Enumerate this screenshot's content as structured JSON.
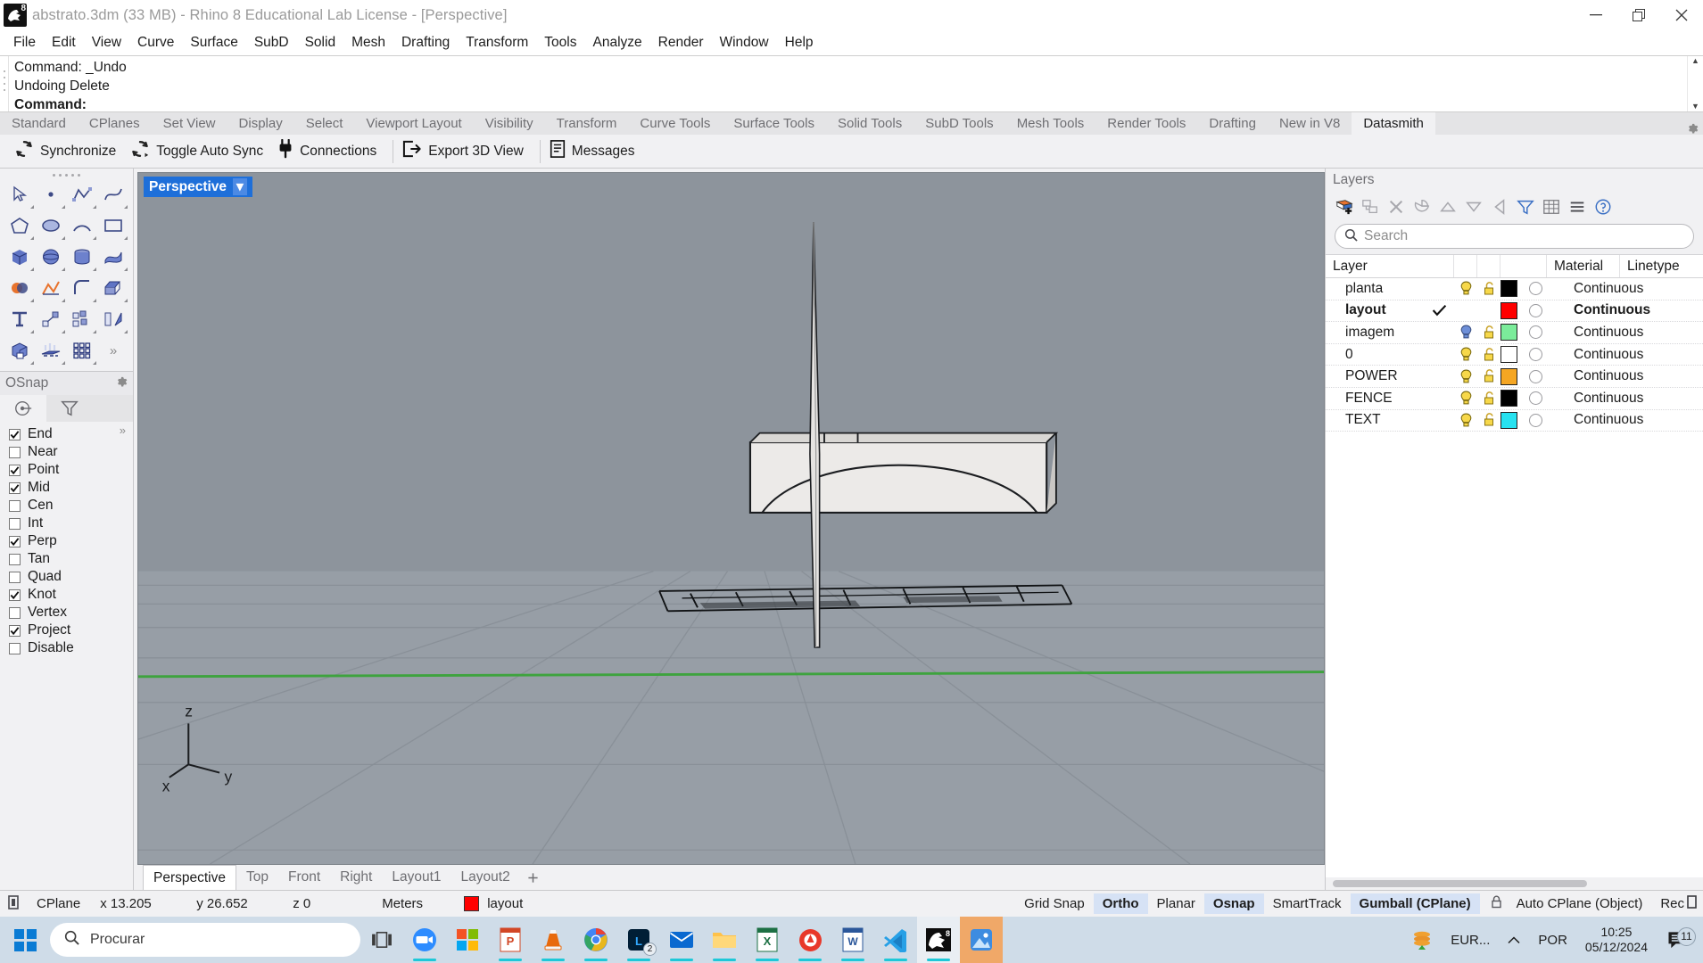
{
  "titlebar": {
    "title": "abstrato.3dm (33 MB) - Rhino 8 Educational Lab License - [Perspective]",
    "app_icon": "rhino-icon",
    "minimize": "minimize-icon",
    "restore": "restore-icon",
    "close": "close-icon"
  },
  "menu": [
    "File",
    "Edit",
    "View",
    "Curve",
    "Surface",
    "SubD",
    "Solid",
    "Mesh",
    "Drafting",
    "Transform",
    "Tools",
    "Analyze",
    "Render",
    "Window",
    "Help"
  ],
  "command": {
    "line1": "Command: _Undo",
    "line2": "Undoing Delete",
    "line3": "Command:"
  },
  "toolbar_tabs": [
    {
      "label": "Standard",
      "active": false
    },
    {
      "label": "CPlanes",
      "active": false
    },
    {
      "label": "Set View",
      "active": false
    },
    {
      "label": "Display",
      "active": false
    },
    {
      "label": "Select",
      "active": false
    },
    {
      "label": "Viewport Layout",
      "active": false
    },
    {
      "label": "Visibility",
      "active": false
    },
    {
      "label": "Transform",
      "active": false
    },
    {
      "label": "Curve Tools",
      "active": false
    },
    {
      "label": "Surface Tools",
      "active": false
    },
    {
      "label": "Solid Tools",
      "active": false
    },
    {
      "label": "SubD Tools",
      "active": false
    },
    {
      "label": "Mesh Tools",
      "active": false
    },
    {
      "label": "Render Tools",
      "active": false
    },
    {
      "label": "Drafting",
      "active": false
    },
    {
      "label": "New in V8",
      "active": false
    },
    {
      "label": "Datasmith",
      "active": true
    }
  ],
  "datasmith_toolbar": [
    {
      "label": "Synchronize",
      "icon": "sync-icon"
    },
    {
      "label": "Toggle Auto Sync",
      "icon": "auto-sync-icon"
    },
    {
      "label": "Connections",
      "icon": "plug-icon"
    },
    {
      "label": "Export 3D View",
      "icon": "export-icon"
    },
    {
      "label": "Messages",
      "icon": "messages-icon"
    }
  ],
  "osnap": {
    "title": "OSnap",
    "gear": "gear-icon",
    "tab_snap": "snap-target-icon",
    "tab_filter": "filter-icon",
    "items": [
      {
        "label": "End",
        "checked": true
      },
      {
        "label": "Near",
        "checked": false
      },
      {
        "label": "Point",
        "checked": true
      },
      {
        "label": "Mid",
        "checked": true
      },
      {
        "label": "Cen",
        "checked": false
      },
      {
        "label": "Int",
        "checked": false
      },
      {
        "label": "Perp",
        "checked": true
      },
      {
        "label": "Tan",
        "checked": false
      },
      {
        "label": "Quad",
        "checked": false
      },
      {
        "label": "Knot",
        "checked": true
      },
      {
        "label": "Vertex",
        "checked": false
      },
      {
        "label": "Project",
        "checked": true
      },
      {
        "label": "Disable",
        "checked": false
      }
    ]
  },
  "viewport": {
    "label": "Perspective",
    "caret": "▾",
    "axis_z": "z",
    "axis_x": "x",
    "axis_y": "y",
    "background": "#8d949c",
    "ground": "#9aa1a8",
    "grid_line": "#7e848b",
    "axis_green": "#3ea33e"
  },
  "viewport_tabs": [
    {
      "label": "Perspective",
      "active": true
    },
    {
      "label": "Top",
      "active": false
    },
    {
      "label": "Front",
      "active": false
    },
    {
      "label": "Right",
      "active": false
    },
    {
      "label": "Layout1",
      "active": false
    },
    {
      "label": "Layout2",
      "active": false
    }
  ],
  "layers": {
    "title": "Layers",
    "search_placeholder": "Search",
    "search_value": "",
    "search_icon": "search-icon",
    "tools": [
      "new-layer-icon",
      "new-sublayer-icon",
      "delete-layer-icon",
      "duplicate-layer-icon",
      "move-up-icon",
      "move-down-icon",
      "back-icon",
      "filter-icon",
      "grid-icon",
      "menu-icon",
      "help-icon"
    ],
    "columns": [
      "Layer",
      "",
      "",
      "",
      "Material",
      "Linetype"
    ],
    "rows": [
      {
        "name": "planta",
        "current": false,
        "bulb": "on",
        "lock": "unlocked",
        "color": "#000000",
        "material": "material-circle",
        "linetype": "Continuous"
      },
      {
        "name": "layout",
        "current": true,
        "bulb": "none",
        "lock": "none",
        "color": "#ff0000",
        "material": "material-circle",
        "linetype": "Continuous"
      },
      {
        "name": "imagem",
        "current": false,
        "bulb": "off",
        "lock": "unlocked",
        "color": "#7bec9a",
        "material": "material-circle",
        "linetype": "Continuous"
      },
      {
        "name": "0",
        "current": false,
        "bulb": "on",
        "lock": "unlocked",
        "color": "#ffffff",
        "material": "material-circle",
        "linetype": "Continuous"
      },
      {
        "name": "POWER",
        "current": false,
        "bulb": "on",
        "lock": "unlocked",
        "color": "#f5a623",
        "material": "material-circle",
        "linetype": "Continuous"
      },
      {
        "name": "FENCE",
        "current": false,
        "bulb": "on",
        "lock": "unlocked",
        "color": "#000000",
        "material": "material-circle",
        "linetype": "Continuous"
      },
      {
        "name": "TEXT",
        "current": false,
        "bulb": "on",
        "lock": "unlocked",
        "color": "#27e2f0",
        "material": "material-circle",
        "linetype": "Continuous"
      }
    ]
  },
  "statusbar": {
    "cplane": "CPlane",
    "x": "x 13.205",
    "y": "y 26.652",
    "z": "z 0",
    "units": "Meters",
    "layer_color": "#ff0000",
    "layer_name": "layout",
    "toggles": [
      {
        "label": "Grid Snap",
        "on": false
      },
      {
        "label": "Ortho",
        "on": true
      },
      {
        "label": "Planar",
        "on": false
      },
      {
        "label": "Osnap",
        "on": true
      },
      {
        "label": "SmartTrack",
        "on": false
      },
      {
        "label": "Gumball (CPlane)",
        "on": true
      }
    ],
    "lock_icon": "lock-icon",
    "auto_cplane": "Auto CPlane (Object)",
    "record": "Rec"
  },
  "taskbar": {
    "start": "windows-start-icon",
    "search_placeholder": "Procurar",
    "search_icon": "search-icon",
    "apps": [
      {
        "name": "task-view-icon",
        "running": false
      },
      {
        "name": "zoom-icon",
        "running": true
      },
      {
        "name": "microsoft-store-icon",
        "running": false
      },
      {
        "name": "powerpoint-icon",
        "running": true
      },
      {
        "name": "vlc-icon",
        "running": true
      },
      {
        "name": "chrome-icon",
        "running": true
      },
      {
        "name": "lightroom-icon",
        "running": true,
        "badge": "2"
      },
      {
        "name": "mail-icon",
        "running": true
      },
      {
        "name": "file-explorer-icon",
        "running": true
      },
      {
        "name": "excel-icon",
        "running": true
      },
      {
        "name": "avira-icon",
        "running": true
      },
      {
        "name": "word-icon",
        "running": true
      },
      {
        "name": "vscode-icon",
        "running": true
      },
      {
        "name": "rhino-icon",
        "running": true,
        "badge": "8"
      },
      {
        "name": "photos-icon",
        "running": true
      }
    ],
    "currency": "EUR...",
    "chevron": "chevron-up-icon",
    "language": "POR",
    "time": "10:25",
    "date": "05/12/2024",
    "notification_icon": "notification-icon",
    "notification_count": "11"
  }
}
